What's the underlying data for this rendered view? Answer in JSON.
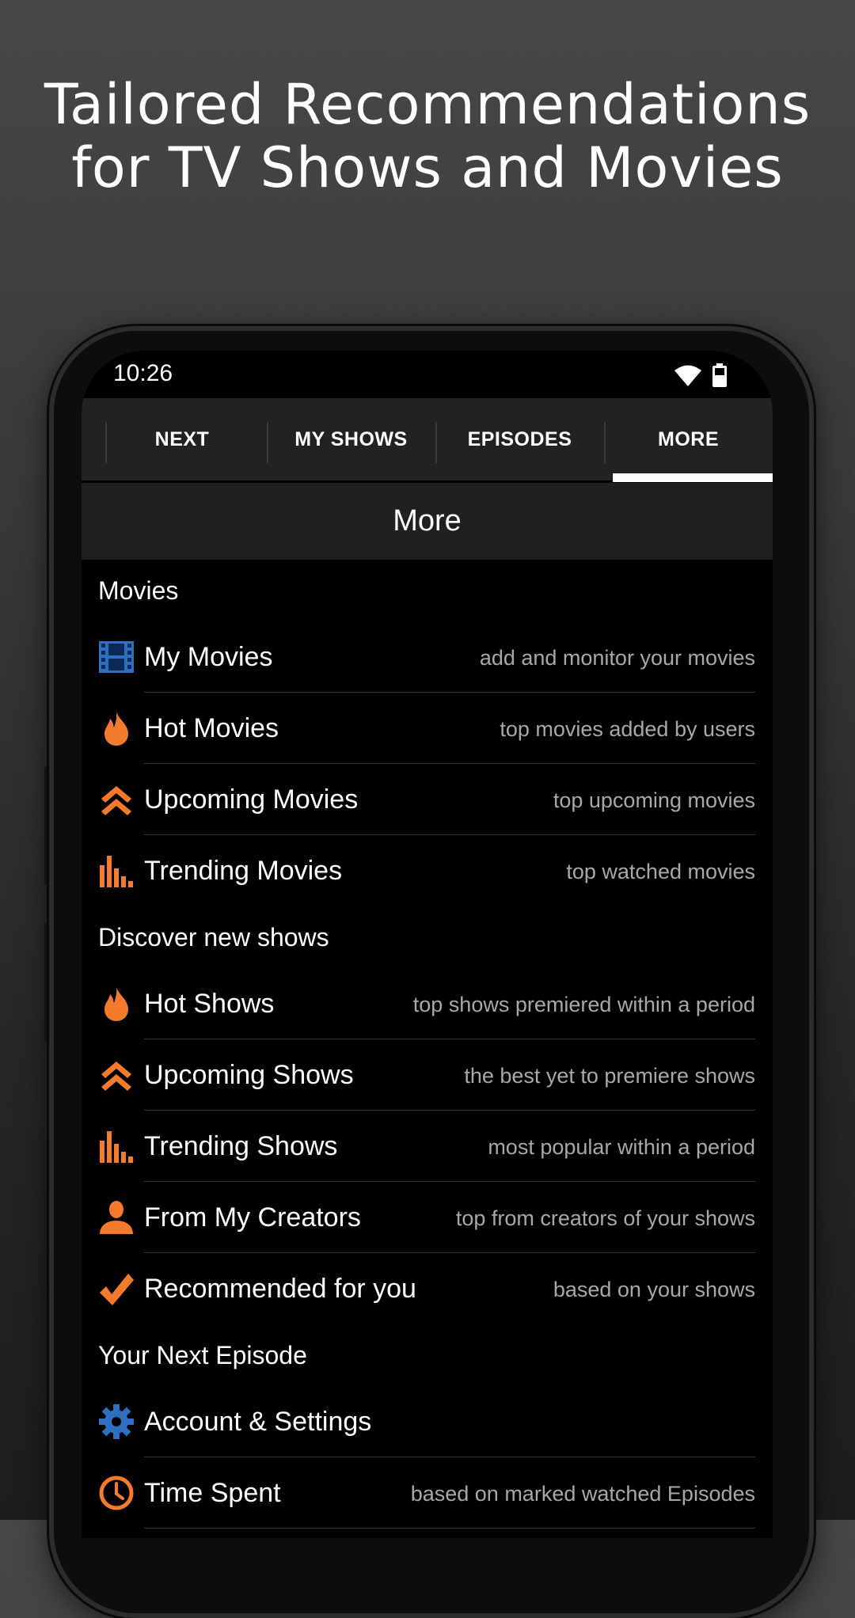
{
  "headline": {
    "line1": "Tailored Recommendations",
    "line2": "for TV Shows and Movies"
  },
  "status_bar": {
    "time": "10:26"
  },
  "tabs": [
    {
      "label": "NEXT",
      "active": false
    },
    {
      "label": "MY SHOWS",
      "active": false
    },
    {
      "label": "EPISODES",
      "active": false
    },
    {
      "label": "MORE",
      "active": true
    }
  ],
  "page_title": "More",
  "accent_color": "#f47a2c",
  "sections": [
    {
      "title": "Movies",
      "items": [
        {
          "label": "My Movies",
          "desc": "add and monitor your movies",
          "icon": "film-icon"
        },
        {
          "label": "Hot Movies",
          "desc": "top movies added by users",
          "icon": "flame-icon"
        },
        {
          "label": "Upcoming Movies",
          "desc": "top upcoming movies",
          "icon": "double-chevron-up-icon"
        },
        {
          "label": "Trending Movies",
          "desc": "top watched movies",
          "icon": "bar-chart-icon"
        }
      ]
    },
    {
      "title": "Discover new shows",
      "items": [
        {
          "label": "Hot Shows",
          "desc": "top shows premiered within a period",
          "icon": "flame-icon"
        },
        {
          "label": "Upcoming Shows",
          "desc": "the best yet to premiere shows",
          "icon": "double-chevron-up-icon"
        },
        {
          "label": "Trending Shows",
          "desc": "most popular within a period",
          "icon": "bar-chart-icon"
        },
        {
          "label": "From My Creators",
          "desc": "top from creators of your shows",
          "icon": "person-icon"
        },
        {
          "label": "Recommended for you",
          "desc": "based on your shows",
          "icon": "checkmark-icon"
        }
      ]
    },
    {
      "title": "Your Next Episode",
      "items": [
        {
          "label": "Account & Settings",
          "desc": "",
          "icon": "gear-icon"
        },
        {
          "label": "Time Spent",
          "desc": "based on marked watched Episodes",
          "icon": "clock-icon"
        }
      ]
    }
  ]
}
